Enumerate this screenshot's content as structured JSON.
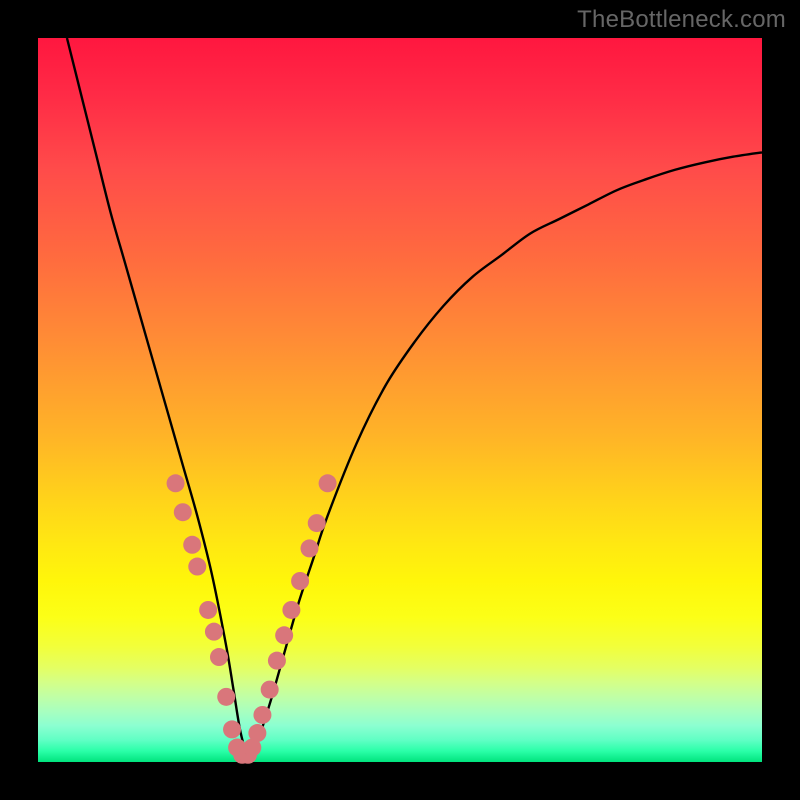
{
  "watermark": "TheBottleneck.com",
  "chart_data": {
    "type": "line",
    "title": "",
    "xlabel": "",
    "ylabel": "",
    "xlim": [
      0,
      100
    ],
    "ylim": [
      0,
      100
    ],
    "series": [
      {
        "name": "bottleneck-curve",
        "x": [
          4,
          6,
          8,
          10,
          12,
          14,
          16,
          18,
          20,
          22,
          24,
          26,
          27,
          28,
          29,
          30,
          32,
          34,
          36,
          38,
          40,
          44,
          48,
          52,
          56,
          60,
          64,
          68,
          72,
          76,
          80,
          84,
          88,
          92,
          96,
          100
        ],
        "values": [
          100,
          92,
          84,
          76,
          69,
          62,
          55,
          48,
          41,
          34,
          26,
          16,
          10,
          4,
          1,
          2,
          8,
          15,
          22,
          28,
          34,
          44,
          52,
          58,
          63,
          67,
          70,
          73,
          75,
          77,
          79,
          80.5,
          81.8,
          82.8,
          83.6,
          84.2
        ]
      }
    ],
    "markers": {
      "name": "highlight-dots",
      "color": "#d9767b",
      "radius_px": 9,
      "points": [
        {
          "x": 19.0,
          "y": 38.5
        },
        {
          "x": 20.0,
          "y": 34.5
        },
        {
          "x": 21.3,
          "y": 30.0
        },
        {
          "x": 22.0,
          "y": 27.0
        },
        {
          "x": 23.5,
          "y": 21.0
        },
        {
          "x": 24.3,
          "y": 18.0
        },
        {
          "x": 25.0,
          "y": 14.5
        },
        {
          "x": 26.0,
          "y": 9.0
        },
        {
          "x": 26.8,
          "y": 4.5
        },
        {
          "x": 27.5,
          "y": 2.0
        },
        {
          "x": 28.2,
          "y": 1.0
        },
        {
          "x": 29.0,
          "y": 1.0
        },
        {
          "x": 29.6,
          "y": 2.0
        },
        {
          "x": 30.3,
          "y": 4.0
        },
        {
          "x": 31.0,
          "y": 6.5
        },
        {
          "x": 32.0,
          "y": 10.0
        },
        {
          "x": 33.0,
          "y": 14.0
        },
        {
          "x": 34.0,
          "y": 17.5
        },
        {
          "x": 35.0,
          "y": 21.0
        },
        {
          "x": 36.2,
          "y": 25.0
        },
        {
          "x": 37.5,
          "y": 29.5
        },
        {
          "x": 38.5,
          "y": 33.0
        },
        {
          "x": 40.0,
          "y": 38.5
        }
      ]
    },
    "gradient_stops": [
      {
        "pos": 0,
        "color": "#ff173f"
      },
      {
        "pos": 0.5,
        "color": "#ffc020"
      },
      {
        "pos": 0.8,
        "color": "#fbff1a"
      },
      {
        "pos": 1.0,
        "color": "#00e37d"
      }
    ]
  }
}
